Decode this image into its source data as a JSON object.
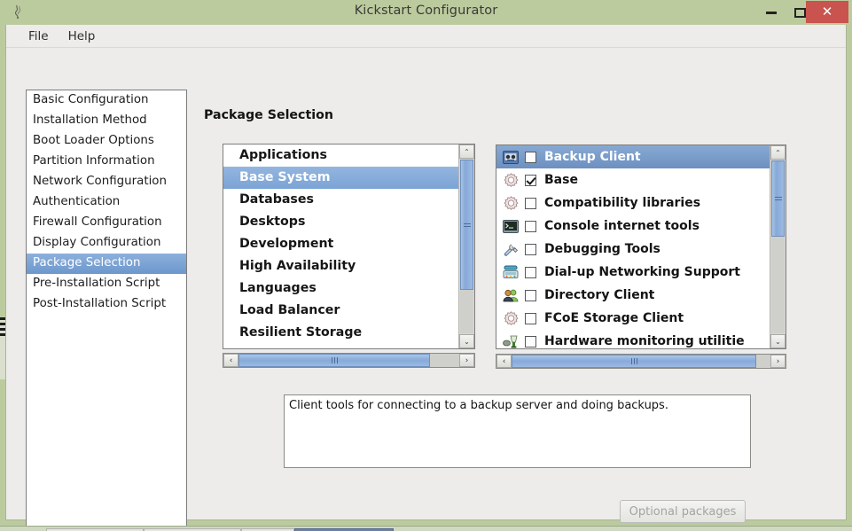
{
  "window": {
    "title": "Kickstart Configurator",
    "icon": "app-icon",
    "buttons": {
      "minimize": "–",
      "maximize": "□",
      "close": "✕"
    }
  },
  "menubar": {
    "items": [
      {
        "label": "File"
      },
      {
        "label": "Help"
      }
    ]
  },
  "sidebar": {
    "items": [
      {
        "label": "Basic Configuration",
        "selected": false
      },
      {
        "label": "Installation Method",
        "selected": false
      },
      {
        "label": "Boot Loader Options",
        "selected": false
      },
      {
        "label": "Partition Information",
        "selected": false
      },
      {
        "label": "Network Configuration",
        "selected": false
      },
      {
        "label": "Authentication",
        "selected": false
      },
      {
        "label": "Firewall Configuration",
        "selected": false
      },
      {
        "label": "Display Configuration",
        "selected": false
      },
      {
        "label": "Package Selection",
        "selected": true
      },
      {
        "label": "Pre-Installation Script",
        "selected": false
      },
      {
        "label": "Post-Installation Script",
        "selected": false
      }
    ]
  },
  "main": {
    "page_title": "Package Selection",
    "categories": [
      {
        "label": "Applications",
        "selected": false
      },
      {
        "label": "Base System",
        "selected": true
      },
      {
        "label": "Databases",
        "selected": false
      },
      {
        "label": "Desktops",
        "selected": false
      },
      {
        "label": "Development",
        "selected": false
      },
      {
        "label": "High Availability",
        "selected": false
      },
      {
        "label": "Languages",
        "selected": false
      },
      {
        "label": "Load Balancer",
        "selected": false
      },
      {
        "label": "Resilient Storage",
        "selected": false
      }
    ],
    "packages": [
      {
        "label": "Backup Client",
        "checked": false,
        "selected": true,
        "icon": "tape-drive-icon"
      },
      {
        "label": "Base",
        "checked": true,
        "selected": false,
        "icon": "gear-icon"
      },
      {
        "label": "Compatibility libraries",
        "checked": false,
        "selected": false,
        "icon": "gear-icon"
      },
      {
        "label": "Console internet tools",
        "checked": false,
        "selected": false,
        "icon": "terminal-icon"
      },
      {
        "label": "Debugging Tools",
        "checked": false,
        "selected": false,
        "icon": "tools-icon"
      },
      {
        "label": "Dial-up Networking Support",
        "checked": false,
        "selected": false,
        "icon": "telephone-icon"
      },
      {
        "label": "Directory Client",
        "checked": false,
        "selected": false,
        "icon": "users-icon"
      },
      {
        "label": "FCoE Storage Client",
        "checked": false,
        "selected": false,
        "icon": "gear-icon"
      },
      {
        "label": "Hardware monitoring utilitie",
        "checked": false,
        "selected": false,
        "icon": "hardware-monitor-icon"
      }
    ],
    "description": "Client tools for connecting to a backup server and doing backups.",
    "optional_button": "Optional packages"
  },
  "scrollbars": {
    "arrow_up": "⌃",
    "arrow_down": "⌄",
    "arrow_left": "‹",
    "arrow_right": "›"
  },
  "colors": {
    "titlebar": "#bccb9e",
    "close_button": "#c9534e",
    "selection_blue": "#7ba3d4",
    "window_bg": "#edecea",
    "list_bg": "#ffffff"
  }
}
